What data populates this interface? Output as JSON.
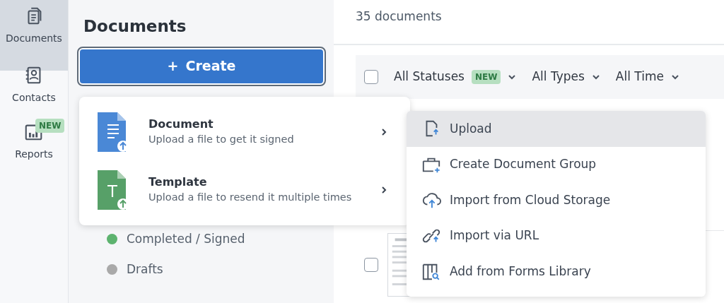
{
  "rail": {
    "items": [
      {
        "label": "Documents",
        "kind": "documents",
        "selected": true
      },
      {
        "label": "Contacts",
        "kind": "contacts",
        "selected": false
      },
      {
        "label": "Reports",
        "kind": "reports",
        "selected": false,
        "badge": "NEW"
      }
    ]
  },
  "sidebar": {
    "title": "Documents",
    "create_button": {
      "icon": "+",
      "label": "Create"
    },
    "statuses": [
      {
        "label": "Completed / Signed",
        "color": "#5db36f"
      },
      {
        "label": "Drafts",
        "color": "#a9a9a9"
      }
    ]
  },
  "main": {
    "count": "35 documents",
    "select_all": {
      "checked": false
    },
    "filters": [
      {
        "label": "All Statuses",
        "badge": "NEW"
      },
      {
        "label": "All Types"
      },
      {
        "label": "All Time"
      }
    ]
  },
  "create_menu": {
    "items": [
      {
        "title": "Document",
        "description": "Upload a file to get it signed",
        "kind": "document"
      },
      {
        "title": "Template",
        "description": "Upload a file to resend it multiple times",
        "kind": "template"
      }
    ]
  },
  "upload_menu": {
    "items": [
      {
        "label": "Upload",
        "kind": "upload",
        "selected": true
      },
      {
        "label": "Create Document Group",
        "kind": "group",
        "selected": false
      },
      {
        "label": "Import from Cloud Storage",
        "kind": "cloud",
        "selected": false
      },
      {
        "label": "Import via URL",
        "kind": "link",
        "selected": false
      },
      {
        "label": "Add from Forms Library",
        "kind": "library",
        "selected": false
      }
    ]
  }
}
